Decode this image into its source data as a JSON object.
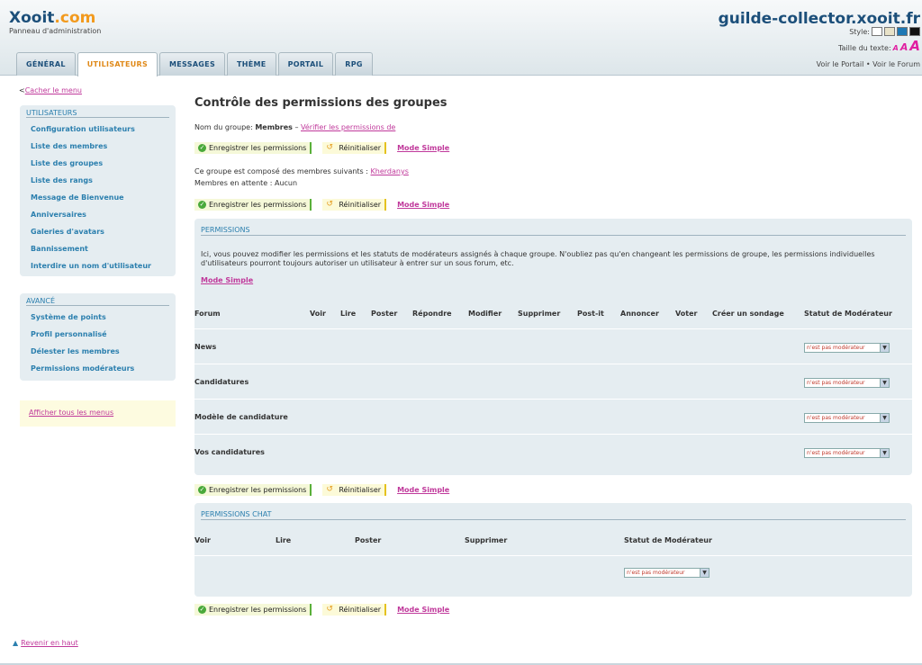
{
  "header": {
    "logo_main": "Xooit",
    "logo_dot": ".",
    "logo_suffix": "com",
    "subtitle": "Panneau d'administration",
    "site_name": "guilde-collector.xooit.fr",
    "style_label": "Style:",
    "text_size_label": "Taille du texte:",
    "text_size_small": "A",
    "text_size_medium": "A",
    "text_size_large": "A",
    "portal_link": "Voir le Portail",
    "separator": "•",
    "forum_link": "Voir le Forum",
    "swatch_colors": [
      "#ffffff",
      "#e8e2c8",
      "#1e78b4",
      "#111111"
    ]
  },
  "tabs": [
    {
      "label": "GÉNÉRAL"
    },
    {
      "label": "UTILISATEURS"
    },
    {
      "label": "MESSAGES"
    },
    {
      "label": "THÈME"
    },
    {
      "label": "PORTAIL"
    },
    {
      "label": "RPG"
    }
  ],
  "sidebar": {
    "hide_menu_arrow": "<",
    "hide_menu": "Cacher le menu",
    "users_title": "UTILISATEURS",
    "users_items": [
      "Configuration utilisateurs",
      "Liste des membres",
      "Liste des groupes",
      "Liste des rangs",
      "Message de Bienvenue",
      "Anniversaires",
      "Galeries d'avatars",
      "Bannissement",
      "Interdire un nom d'utilisateur"
    ],
    "advanced_title": "AVANCÉ",
    "advanced_items": [
      "Système de points",
      "Profil personnalisé",
      "Délester les membres",
      "Permissions modérateurs"
    ],
    "show_all_menus": "Afficher tous les menus",
    "back_to_top": "Revenir en haut"
  },
  "main": {
    "title": "Contrôle des permissions des groupes",
    "group_label": "Nom du groupe:",
    "group_name": "Membres",
    "group_dash": "–",
    "verify_link": "Vérifier les permissions de",
    "save_label": "Enregistrer les permissions",
    "reset_label": "Réinitialiser",
    "simple_mode": "Mode Simple",
    "members_text": "Ce groupe est composé des membres suivants :",
    "member_name": "Kherdanys",
    "pending_text": "Membres en attente : Aucun"
  },
  "permissions": {
    "title": "PERMISSIONS",
    "description": "Ici, vous pouvez modifier les permissions et les statuts de modérateurs assignés à chaque groupe. N'oubliez pas qu'en changeant les permissions de groupe, les permissions individuelles d'utilisateurs pourront toujours autoriser un utilisateur à entrer sur un sous forum, etc.",
    "mode_link": "Mode Simple",
    "columns": [
      "Forum",
      "Voir",
      "Lire",
      "Poster",
      "Répondre",
      "Modifier",
      "Supprimer",
      "Post-it",
      "Annoncer",
      "Voter",
      "Créer un sondage",
      "Statut de Modérateur"
    ],
    "rows": [
      {
        "forum": "News",
        "status": "n'est pas modérateur"
      },
      {
        "forum": "Candidatures",
        "status": "n'est pas modérateur"
      },
      {
        "forum": "Modèle de candidature",
        "status": "n'est pas modérateur"
      },
      {
        "forum": "Vos candidatures",
        "status": "n'est pas modérateur"
      }
    ]
  },
  "chat": {
    "title": "PERMISSIONS CHAT",
    "columns": [
      "Voir",
      "Lire",
      "Poster",
      "Supprimer",
      "Statut de Modérateur"
    ],
    "status": "n'est pas modérateur"
  }
}
